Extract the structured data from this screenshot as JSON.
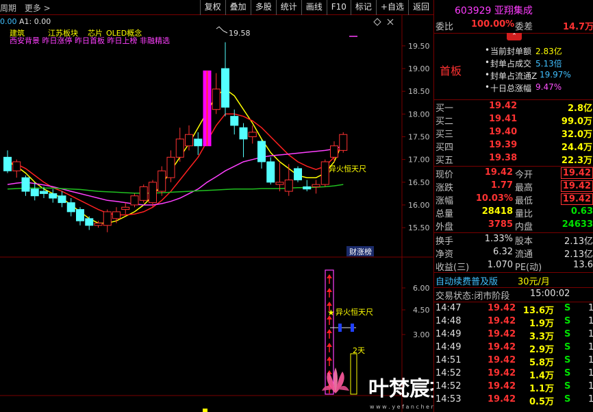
{
  "topbar": {
    "left_items": [
      "周期",
      "更多 >"
    ],
    "buttons": [
      "复权",
      "叠加",
      "多股",
      "统计",
      "画线",
      "F10",
      "标记",
      "+自选",
      "返回"
    ]
  },
  "stock": {
    "code": "603929",
    "name": "亚翔集成"
  },
  "chart": {
    "info_prefix": "0.00",
    "indicator": "A1: 0.00",
    "concepts_line1": [
      "建筑",
      "江苏板块",
      "芯片",
      "OLED概念"
    ],
    "concepts_line2": "西安背景 昨日涨停 昨日首板 昨日上榜 非融精选",
    "high_label": "19.58",
    "price_ticks": [
      "19.50",
      "19.00",
      "18.50",
      "18.00",
      "17.50",
      "17.00",
      "16.50",
      "16.00",
      "15.50"
    ],
    "signal_label": "异火恒天尺",
    "report_badge": "财涨榜",
    "lower_ticks": [
      "6.00",
      "4.50",
      "3.00"
    ],
    "lower_signal": "异火恒天尺",
    "lower_days": "2天",
    "watermark_title": "叶梵宸指标公式网",
    "watermark_url": "w w w . y e f a n c h e n . c o m   指 标 公 式 网"
  },
  "chart_data": {
    "type": "candlestick",
    "ylim": [
      15.2,
      19.8
    ],
    "candles": [
      {
        "o": 17.05,
        "c": 16.75,
        "h": 17.2,
        "l": 16.7
      },
      {
        "o": 16.75,
        "c": 16.95,
        "h": 17.0,
        "l": 16.6
      },
      {
        "o": 16.6,
        "c": 16.3,
        "h": 16.65,
        "l": 16.2
      },
      {
        "o": 16.35,
        "c": 16.2,
        "h": 16.5,
        "l": 16.1
      },
      {
        "o": 16.3,
        "c": 16.25,
        "h": 16.4,
        "l": 16.15
      },
      {
        "o": 16.25,
        "c": 16.15,
        "h": 16.35,
        "l": 16.05
      },
      {
        "o": 16.2,
        "c": 16.05,
        "h": 16.3,
        "l": 15.95
      },
      {
        "o": 16.05,
        "c": 15.85,
        "h": 16.15,
        "l": 15.75
      },
      {
        "o": 15.9,
        "c": 15.65,
        "h": 15.95,
        "l": 15.55
      },
      {
        "o": 15.7,
        "c": 15.55,
        "h": 15.75,
        "l": 15.45
      },
      {
        "o": 15.55,
        "c": 15.6,
        "h": 15.65,
        "l": 15.5
      },
      {
        "o": 15.55,
        "c": 15.85,
        "h": 15.9,
        "l": 15.4
      },
      {
        "o": 15.7,
        "c": 15.85,
        "h": 15.95,
        "l": 15.6
      },
      {
        "o": 15.9,
        "c": 15.95,
        "h": 16.05,
        "l": 15.8
      },
      {
        "o": 16.0,
        "c": 16.2,
        "h": 16.25,
        "l": 15.95
      },
      {
        "o": 16.1,
        "c": 16.4,
        "h": 16.45,
        "l": 16.05
      },
      {
        "o": 16.05,
        "c": 16.5,
        "h": 16.55,
        "l": 15.95
      },
      {
        "o": 16.3,
        "c": 16.75,
        "h": 16.85,
        "l": 16.2
      },
      {
        "o": 16.6,
        "c": 17.05,
        "h": 17.2,
        "l": 16.5
      },
      {
        "o": 17.05,
        "c": 17.45,
        "h": 17.7,
        "l": 16.95
      },
      {
        "o": 17.3,
        "c": 17.55,
        "h": 17.75,
        "l": 17.2
      },
      {
        "o": 17.45,
        "c": 17.3,
        "h": 17.6,
        "l": 17.1
      },
      {
        "o": 17.3,
        "c": 18.95,
        "h": 18.95,
        "l": 17.3
      },
      {
        "o": 18.1,
        "c": 18.55,
        "h": 18.9,
        "l": 18.0
      },
      {
        "o": 19.0,
        "c": 18.15,
        "h": 19.58,
        "l": 17.95
      },
      {
        "o": 17.95,
        "c": 17.75,
        "h": 18.1,
        "l": 17.55
      },
      {
        "o": 17.7,
        "c": 17.45,
        "h": 17.8,
        "l": 17.05
      },
      {
        "o": 17.5,
        "c": 17.6,
        "h": 17.75,
        "l": 17.35
      },
      {
        "o": 17.4,
        "c": 16.95,
        "h": 17.45,
        "l": 16.8
      },
      {
        "o": 16.95,
        "c": 16.5,
        "h": 17.05,
        "l": 16.45
      },
      {
        "o": 16.45,
        "c": 16.5,
        "h": 16.95,
        "l": 16.3
      },
      {
        "o": 16.3,
        "c": 16.55,
        "h": 16.9,
        "l": 16.2
      },
      {
        "o": 16.8,
        "c": 16.55,
        "h": 16.85,
        "l": 16.5
      },
      {
        "o": 16.4,
        "c": 16.35,
        "h": 16.55,
        "l": 16.3
      },
      {
        "o": 16.4,
        "c": 16.45,
        "h": 16.55,
        "l": 16.25
      },
      {
        "o": 16.45,
        "c": 16.95,
        "h": 17.0,
        "l": 16.4
      },
      {
        "o": 17.05,
        "c": 17.3,
        "h": 17.4,
        "l": 16.95
      },
      {
        "o": 17.2,
        "c": 17.55,
        "h": 17.6,
        "l": 17.15
      }
    ],
    "series": [
      {
        "color": "#ffff00",
        "values": [
          16.95,
          16.85,
          16.7,
          16.5,
          16.35,
          16.25,
          16.15,
          16.0,
          15.85,
          15.7,
          15.6,
          15.6,
          15.65,
          15.75,
          15.85,
          16.0,
          16.2,
          16.45,
          16.75,
          17.05,
          17.35,
          17.7,
          18.05,
          18.4,
          18.55,
          18.4,
          18.1,
          17.8,
          17.45,
          17.15,
          16.95,
          16.8,
          16.65,
          16.6,
          16.6,
          16.7,
          16.95,
          17.4
        ]
      },
      {
        "color": "#ff2020",
        "values": [
          16.95,
          16.9,
          16.8,
          16.65,
          16.5,
          16.38,
          16.3,
          16.2,
          16.1,
          16.0,
          15.9,
          15.82,
          15.78,
          15.78,
          15.8,
          15.85,
          15.95,
          16.1,
          16.3,
          16.55,
          16.8,
          17.05,
          17.4,
          17.75,
          18.0,
          18.0,
          17.95,
          17.85,
          17.7,
          17.5,
          17.3,
          17.1,
          16.95,
          16.85,
          16.78,
          16.85,
          17.05,
          17.35
        ]
      },
      {
        "color": "#ff40ff",
        "values": [
          16.45,
          16.48,
          16.5,
          16.47,
          16.44,
          16.4,
          16.35,
          16.3,
          16.25,
          16.2,
          16.15,
          16.1,
          16.08,
          16.05,
          16.02,
          16.0,
          16.0,
          16.03,
          16.08,
          16.15,
          16.25,
          16.35,
          16.5,
          16.62,
          16.75,
          16.85,
          16.95,
          17.0,
          17.05,
          17.08,
          17.1,
          17.12,
          17.14,
          17.16,
          17.18,
          17.2,
          17.23,
          17.3
        ]
      },
      {
        "color": "#20c020",
        "values": [
          16.35,
          16.36,
          16.37,
          16.37,
          16.37,
          16.37,
          16.36,
          16.35,
          16.34,
          16.32,
          16.3,
          16.29,
          16.28,
          16.27,
          16.26,
          16.26,
          16.26,
          16.27,
          16.28,
          16.29,
          16.3,
          16.31,
          16.32,
          16.33,
          16.34,
          16.35,
          16.35,
          16.35,
          16.36,
          16.36,
          16.36,
          16.37,
          16.38,
          16.38,
          16.39,
          16.4,
          16.42,
          16.45
        ]
      }
    ]
  },
  "panel": {
    "weibi_label": "委比",
    "weibi": "100.00%",
    "weicha_label": "委差",
    "weicha": "14.7万",
    "seal_rows": [
      {
        "label": "当前封单额",
        "value": "2.83亿"
      },
      {
        "label": "封单占成交",
        "value": "5.13倍"
      },
      {
        "label": "封单占流通Z",
        "value": "19.97%"
      },
      {
        "label": "十日总涨幅",
        "value": "9.47%"
      }
    ],
    "first_board": "首板",
    "bids": [
      {
        "label": "买一",
        "price": "19.42",
        "vol": "2.8亿"
      },
      {
        "label": "买二",
        "price": "19.41",
        "vol": "99.0万"
      },
      {
        "label": "买三",
        "price": "19.40",
        "vol": "32.0万"
      },
      {
        "label": "买四",
        "price": "19.39",
        "vol": "24.4万"
      },
      {
        "label": "买五",
        "price": "19.38",
        "vol": "22.3万"
      }
    ],
    "quote": [
      {
        "l1": "现价",
        "v1": "19.42",
        "l2": "今开",
        "v2": "19.42"
      },
      {
        "l1": "涨跌",
        "v1": "1.77",
        "l2": "最高",
        "v2": "19.42"
      },
      {
        "l1": "涨幅",
        "v1": "10.03%",
        "l2": "最低",
        "v2": "19.42"
      },
      {
        "l1": "总量",
        "v1": "28418",
        "l2": "量比",
        "v2": "0.63"
      },
      {
        "l1": "外盘",
        "v1": "3785",
        "l2": "内盘",
        "v2": "24633"
      }
    ],
    "fund": [
      {
        "l1": "换手",
        "v1": "1.33%",
        "l2": "股本",
        "v2": "2.13亿"
      },
      {
        "l1": "净资",
        "v1": "6.32",
        "l2": "流通",
        "v2": "2.13亿"
      },
      {
        "l1": "收益(三)",
        "v1": "1.070",
        "l2": "PE(动)",
        "v2": "13.6"
      }
    ],
    "promo": "自动续费普及版",
    "promo_price": "30元/月",
    "status_label": "交易状态:闭市阶段",
    "status_time": "15:00:02",
    "ticks": [
      {
        "t": "14:47",
        "p": "19.42",
        "v": "13.6万",
        "s": "S",
        "n": "1"
      },
      {
        "t": "14:48",
        "p": "19.42",
        "v": "1.9万",
        "s": "S",
        "n": "1"
      },
      {
        "t": "14:49",
        "p": "19.42",
        "v": "3.3万",
        "s": "S",
        "n": "1"
      },
      {
        "t": "14:49",
        "p": "19.42",
        "v": "2.9万",
        "s": "S",
        "n": "1"
      },
      {
        "t": "14:51",
        "p": "19.42",
        "v": "5.8万",
        "s": "S",
        "n": "1"
      },
      {
        "t": "14:52",
        "p": "19.42",
        "v": "1.4万",
        "s": "S",
        "n": "1"
      },
      {
        "t": "14:52",
        "p": "19.42",
        "v": "1.1万",
        "s": "S",
        "n": "1"
      },
      {
        "t": "14:53",
        "p": "19.42",
        "v": "0.5万",
        "s": "S",
        "n": "1"
      }
    ]
  }
}
